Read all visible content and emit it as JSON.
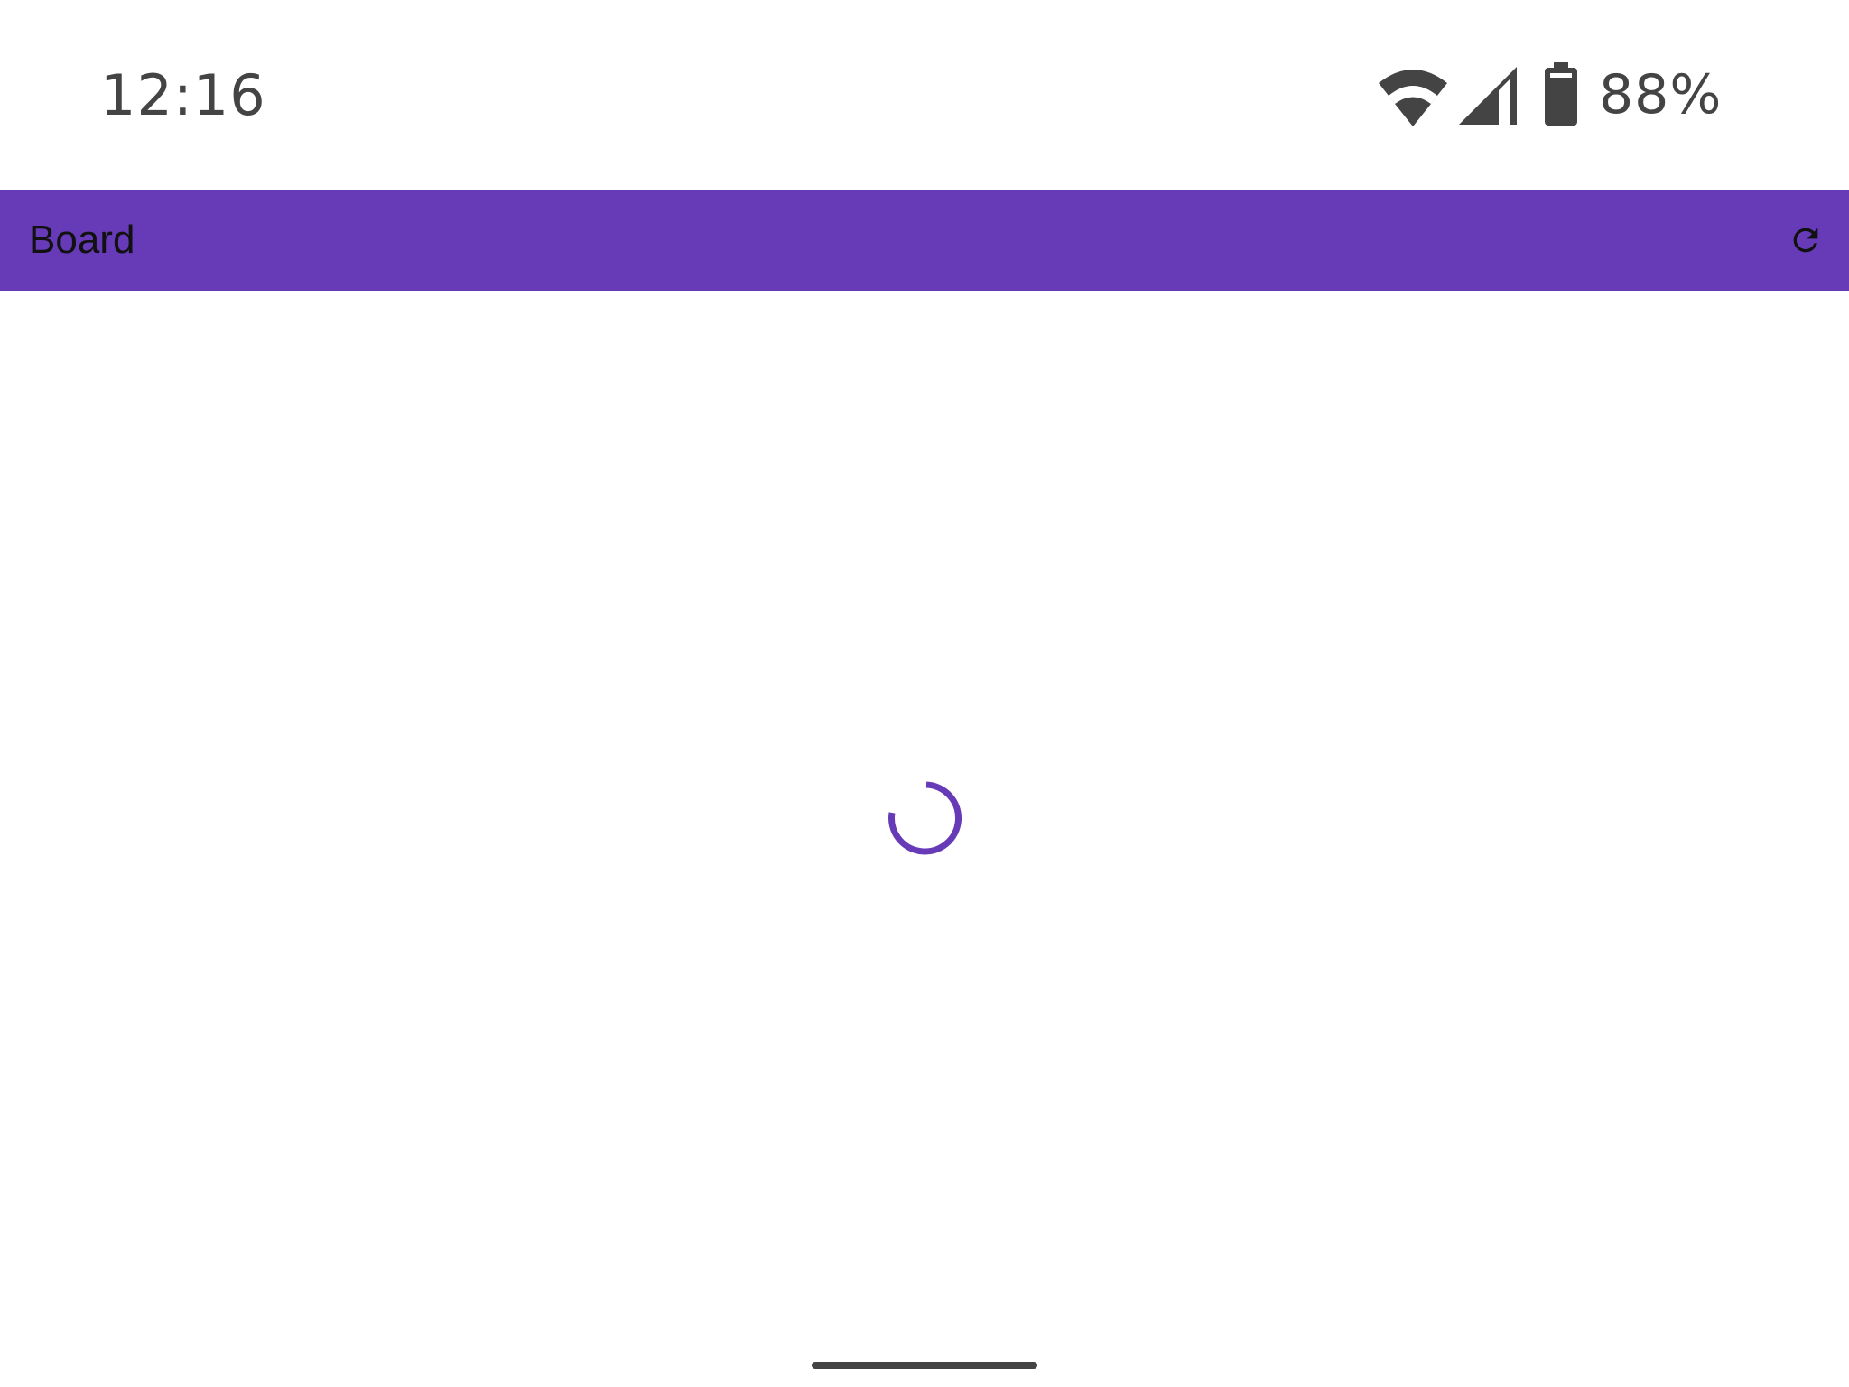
{
  "status_bar": {
    "time": "12:16",
    "battery_percent": "88%",
    "icons": [
      "wifi-icon",
      "cell-signal-icon",
      "battery-icon"
    ]
  },
  "app_bar": {
    "title": "Board",
    "actions": [
      {
        "icon": "refresh-icon"
      }
    ],
    "color": "#673ab7"
  },
  "content": {
    "state": "loading",
    "spinner_color": "#673ab7"
  },
  "colors": {
    "accent": "#673ab7",
    "status_text": "#444444",
    "title_text": "#111111",
    "background": "#ffffff"
  }
}
